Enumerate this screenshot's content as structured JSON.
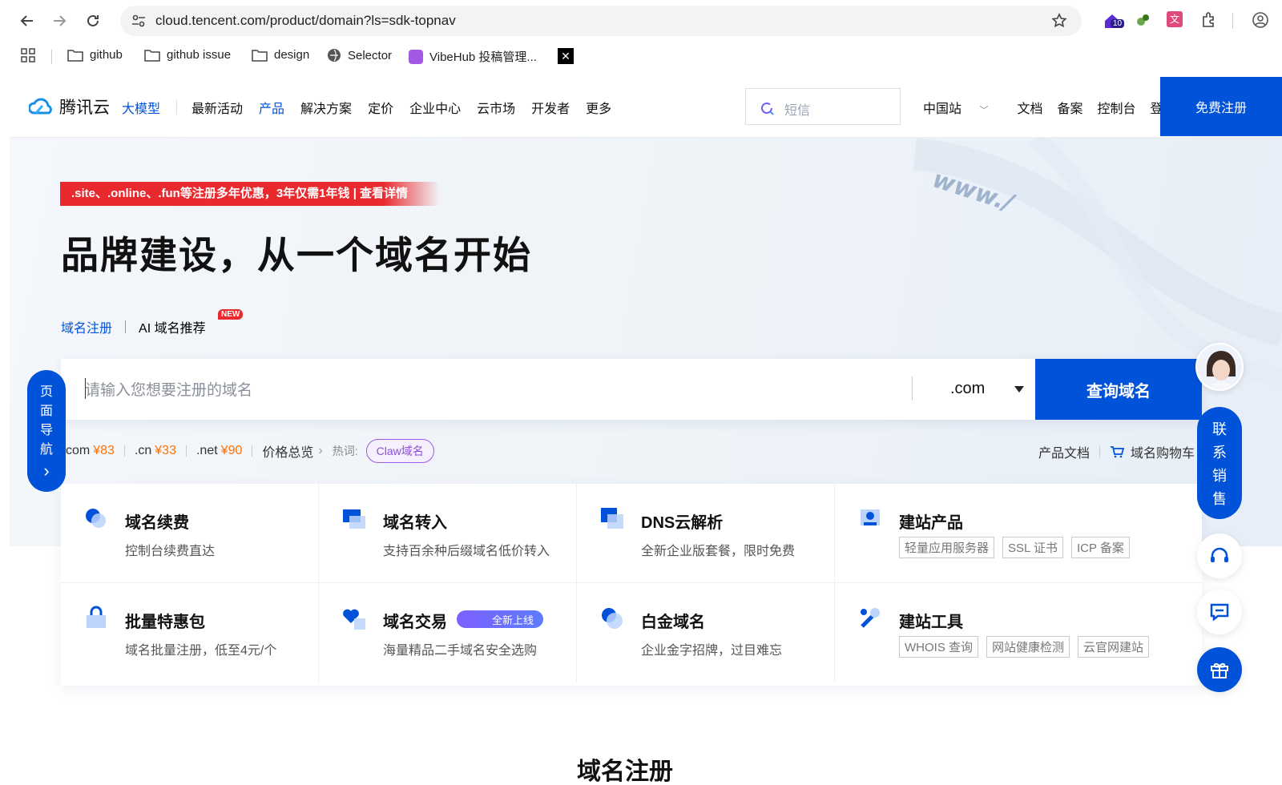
{
  "browser": {
    "url": "cloud.tencent.com/product/domain?ls=sdk-topnav",
    "bookmarks": [
      "github",
      "github issue",
      "design",
      "Selector",
      "VibeHub 投稿管理..."
    ],
    "ext_badge": "10"
  },
  "header": {
    "logo": "腾讯云",
    "menu": [
      "大模型",
      "最新活动",
      "产品",
      "解决方案",
      "定价",
      "企业中心",
      "云市场",
      "开发者",
      "更多"
    ],
    "search_placeholder": "短信",
    "right_links": [
      "中国站",
      "文档",
      "备案",
      "控制台",
      "登录"
    ],
    "register": "免费注册"
  },
  "hero": {
    "promo": ".site、.online、.fun等注册多年优惠，3年仅需1年钱 | 查看详情",
    "title": "品牌建设，从一个域名开始",
    "tab_active": "域名注册",
    "tab_ai": "AI 域名推荐",
    "new_badge": "NEW"
  },
  "search": {
    "placeholder": "请输入您想要注册的域名",
    "tld": ".com",
    "button": "查询域名"
  },
  "prices": [
    {
      "tld": "com",
      "price": "¥83"
    },
    {
      "tld": ".cn",
      "price": "¥33"
    },
    {
      "tld": ".net",
      "price": "¥90"
    }
  ],
  "price_overview": "价格总览",
  "hotword_label": "热词:",
  "hotword": "Claw域名",
  "doc_link": "产品文档",
  "cart_link": "域名购物车",
  "grid": [
    {
      "title": "域名续费",
      "desc": "控制台续费直达",
      "icon": "renew-icon"
    },
    {
      "title": "域名转入",
      "desc": "支持百余种后缀域名低价转入",
      "icon": "transfer-icon"
    },
    {
      "title": "DNS云解析",
      "desc": "全新企业版套餐，限时免费",
      "icon": "dns-icon"
    },
    {
      "title": "建站产品",
      "tags": [
        "轻量应用服务器",
        "SSL 证书",
        "ICP 备案"
      ],
      "icon": "site-product-icon"
    },
    {
      "title": "批量特惠包",
      "desc": "域名批量注册，低至4元/个",
      "icon": "bag-icon"
    },
    {
      "title": "域名交易",
      "desc": "海量精品二手域名安全选购",
      "badge": "全新上线",
      "icon": "heart-icon"
    },
    {
      "title": "白金域名",
      "desc": "企业金字招牌，过目难忘",
      "icon": "platinum-icon"
    },
    {
      "title": "建站工具",
      "tags": [
        "WHOIS 查询",
        "网站健康检测",
        "云官网建站"
      ],
      "icon": "tools-icon"
    }
  ],
  "bottom_title": "域名注册",
  "page_nav": [
    "页",
    "面",
    "导",
    "航"
  ],
  "contact_sales": [
    "联",
    "系",
    "销",
    "售"
  ],
  "colors": {
    "brand": "#0052d9",
    "promo": "#e8292d",
    "price": "#ff7200"
  }
}
